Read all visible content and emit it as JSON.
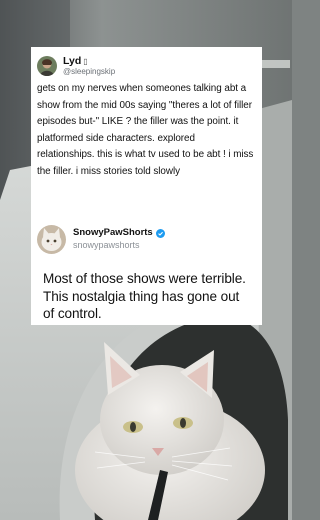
{
  "original_post": {
    "display_name": "Lyd",
    "name_emoji": "▯",
    "handle": "@sleepingskip",
    "text": "gets on my nerves when someones talking abt a show from the mid 00s saying \"theres a lot of filler episodes but-\" LIKE ? the filler was the point. it platformed side characters. explored relationships. this is what tv used to be abt ! i miss the filler. i miss stories told slowly"
  },
  "reply_post": {
    "display_name": "SnowyPawShorts",
    "handle": "snowypawshorts",
    "text": "Most of those shows were terrible. This nostalgia thing has gone out of control."
  },
  "colors": {
    "card_background": "#ffffff",
    "verified_badge": "#1d9bf0",
    "handle_gray": "#6b7076"
  }
}
